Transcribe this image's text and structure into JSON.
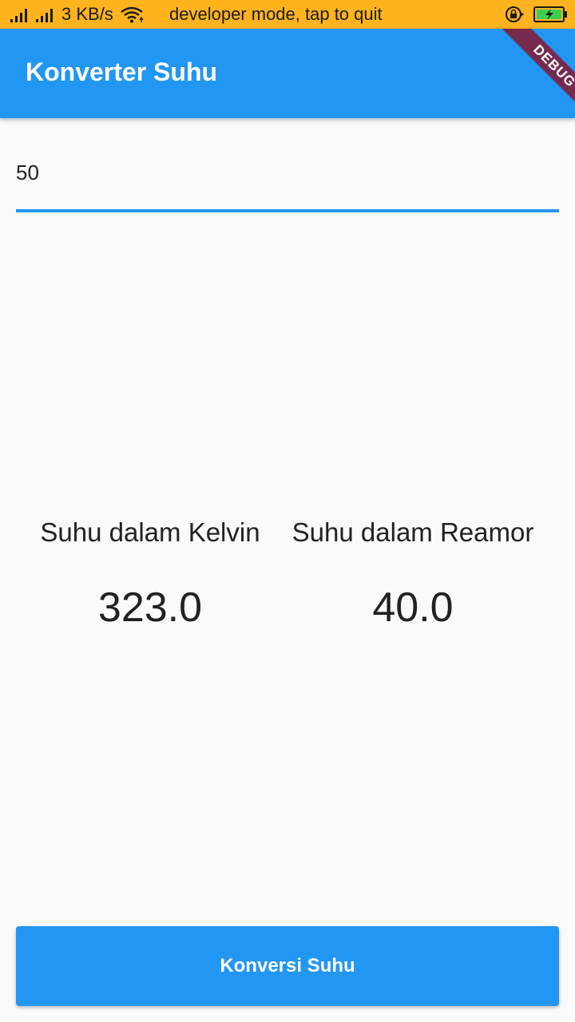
{
  "status_bar": {
    "net_speed": "3 KB/s",
    "message": "developer mode, tap to quit",
    "icons": [
      "signal-icon",
      "signal-icon",
      "wifi-icon",
      "rotation-lock-icon",
      "battery-charging-icon"
    ],
    "background_color": "#ffb31f"
  },
  "app_bar": {
    "title": "Konverter Suhu",
    "color": "#2196f3"
  },
  "debug_banner": {
    "label": "DEBUG"
  },
  "input": {
    "value": "50"
  },
  "results": {
    "kelvin_label": "Suhu dalam Kelvin",
    "kelvin_value": "323.0",
    "reamur_label": "Suhu dalam Reamor",
    "reamur_value": "40.0"
  },
  "button": {
    "label": "Konversi Suhu",
    "color": "#2196f3"
  }
}
